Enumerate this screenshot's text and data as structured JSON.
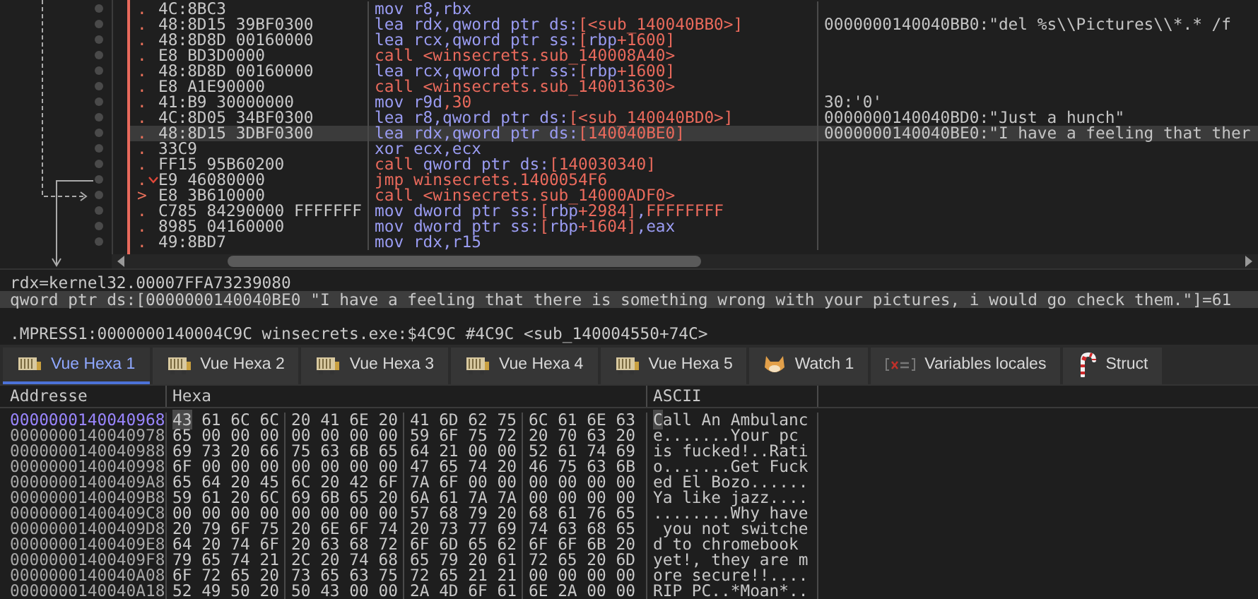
{
  "disassembly": {
    "rows": [
      {
        "mark": ".",
        "bytes": "4C:8BC3",
        "instruction": "mov r8,rbx",
        "kind": "plain",
        "selected": false
      },
      {
        "mark": ".",
        "bytes": "48:8D15 39BF0300",
        "instruction": "lea rdx,qword ptr ds:[<sub_140040BB0>]",
        "kind": "plain",
        "selected": false,
        "comment": "0000000140040BB0:\"del %s\\\\Pictures\\\\*.* /f"
      },
      {
        "mark": ".",
        "bytes": "48:8D8D 00160000",
        "instruction": "lea rcx,qword ptr ss:[rbp+1600]",
        "kind": "plain",
        "selected": false
      },
      {
        "mark": ".",
        "bytes": "E8 BD3D0000",
        "instruction": "call <winsecrets.sub_140008A40>",
        "kind": "call",
        "selected": false
      },
      {
        "mark": ".",
        "bytes": "48:8D8D 00160000",
        "instruction": "lea rcx,qword ptr ss:[rbp+1600]",
        "kind": "plain",
        "selected": false
      },
      {
        "mark": ".",
        "bytes": "E8 A1E90000",
        "instruction": "call <winsecrets.sub_140013630>",
        "kind": "call",
        "selected": false
      },
      {
        "mark": ".",
        "bytes": "41:B9 30000000",
        "instruction": "mov r9d,30",
        "kind": "plain",
        "selected": false,
        "comment": "30:'0'"
      },
      {
        "mark": ".",
        "bytes": "4C:8D05 34BF0300",
        "instruction": "lea r8,qword ptr ds:[<sub_140040BD0>]",
        "kind": "plain",
        "selected": false,
        "comment": "0000000140040BD0:\"Just a hunch\""
      },
      {
        "mark": ".",
        "bytes": "48:8D15 3DBF0300",
        "instruction": "lea rdx,qword ptr ds:[140040BE0]",
        "kind": "plain",
        "selected": true,
        "comment": "0000000140040BE0:\"I have a feeling that ther"
      },
      {
        "mark": ".",
        "bytes": "33C9",
        "instruction": "xor ecx,ecx",
        "kind": "plain",
        "selected": false
      },
      {
        "mark": ".",
        "bytes": "FF15 95B60200",
        "instruction": "call qword ptr ds:[140030340]",
        "kind": "call",
        "selected": false
      },
      {
        "mark": ".",
        "bytes": "E9 46080000",
        "instruction": "jmp winsecrets.1400054F6",
        "kind": "jump",
        "selected": false,
        "branch": true
      },
      {
        "mark": ">",
        "bytes": "E8 3B610000",
        "instruction": "call <winsecrets.sub_14000ADF0>",
        "kind": "call",
        "selected": false
      },
      {
        "mark": ".",
        "bytes": "C785 84290000 FFFFFFF",
        "instruction": "mov dword ptr ss:[rbp+2984],FFFFFFFF",
        "kind": "plain",
        "selected": false
      },
      {
        "mark": ".",
        "bytes": "8985 04160000",
        "instruction": "mov dword ptr ss:[rbp+1604],eax",
        "kind": "plain",
        "selected": false
      },
      {
        "mark": ".",
        "bytes": "49:8BD7",
        "instruction": "mov rdx,r15",
        "kind": "plain",
        "selected": false
      }
    ]
  },
  "info": {
    "lines": [
      {
        "text": "rdx=kernel32.00007FFA73239080",
        "selected": false
      },
      {
        "text": "qword ptr ds:[0000000140040BE0 \"I have a feeling that there is something wrong with your pictures, i would go check them.\"]=61",
        "selected": true
      }
    ],
    "location": ".MPRESS1:0000000140004C9C winsecrets.exe:$4C9C #4C9C <sub_140004550+74C>"
  },
  "tabs": [
    {
      "label": "Vue Hexa 1",
      "kind": "dump",
      "selected": true
    },
    {
      "label": "Vue Hexa 2",
      "kind": "dump",
      "selected": false
    },
    {
      "label": "Vue Hexa 3",
      "kind": "dump",
      "selected": false
    },
    {
      "label": "Vue Hexa 4",
      "kind": "dump",
      "selected": false
    },
    {
      "label": "Vue Hexa 5",
      "kind": "dump",
      "selected": false
    },
    {
      "label": "Watch 1",
      "kind": "watch",
      "selected": false
    },
    {
      "label": "Variables locales",
      "kind": "locals",
      "selected": false
    },
    {
      "label": "Struct",
      "kind": "struct",
      "selected": false
    }
  ],
  "dump": {
    "columns": [
      "Addresse",
      "Hexa",
      "ASCII"
    ],
    "rows": [
      {
        "address": "0000000140040968",
        "bytes": "43 61 6C 6C 20 41 6E 20 41 6D 62 75 6C 61 6E 63",
        "ascii": "Call An Ambulanc",
        "selected": true
      },
      {
        "address": "0000000140040978",
        "bytes": "65 00 00 00 00 00 00 00 59 6F 75 72 20 70 63 20",
        "ascii": "e.......Your pc ",
        "selected": false
      },
      {
        "address": "0000000140040988",
        "bytes": "69 73 20 66 75 63 6B 65 64 21 00 00 52 61 74 69",
        "ascii": "is fucked!..Rati",
        "selected": false
      },
      {
        "address": "0000000140040998",
        "bytes": "6F 00 00 00 00 00 00 00 47 65 74 20 46 75 63 6B",
        "ascii": "o.......Get Fuck",
        "selected": false
      },
      {
        "address": "00000001400409A8",
        "bytes": "65 64 20 45 6C 20 42 6F 7A 6F 00 00 00 00 00 00",
        "ascii": "ed El Bozo......",
        "selected": false
      },
      {
        "address": "00000001400409B8",
        "bytes": "59 61 20 6C 69 6B 65 20 6A 61 7A 7A 00 00 00 00",
        "ascii": "Ya like jazz....",
        "selected": false
      },
      {
        "address": "00000001400409C8",
        "bytes": "00 00 00 00 00 00 00 00 57 68 79 20 68 61 76 65",
        "ascii": "........Why have",
        "selected": false
      },
      {
        "address": "00000001400409D8",
        "bytes": "20 79 6F 75 20 6E 6F 74 20 73 77 69 74 63 68 65",
        "ascii": " you not switche",
        "selected": false
      },
      {
        "address": "00000001400409E8",
        "bytes": "64 20 74 6F 20 63 68 72 6F 6D 65 62 6F 6F 6B 20",
        "ascii": "d to chromebook ",
        "selected": false
      },
      {
        "address": "00000001400409F8",
        "bytes": "79 65 74 21 2C 20 74 68 65 79 20 61 72 65 20 6D",
        "ascii": "yet!, they are m",
        "selected": false
      },
      {
        "address": "0000000140040A08",
        "bytes": "6F 72 65 20 73 65 63 75 72 65 21 21 00 00 00 00",
        "ascii": "ore secure!!....",
        "selected": false
      },
      {
        "address": "0000000140040A18",
        "bytes": "52 49 50 20 50 43 00 00 2A 4D 6F 61 6E 2A 00 00",
        "ascii": "RIP PC..*Moan*..",
        "selected": false
      }
    ]
  }
}
